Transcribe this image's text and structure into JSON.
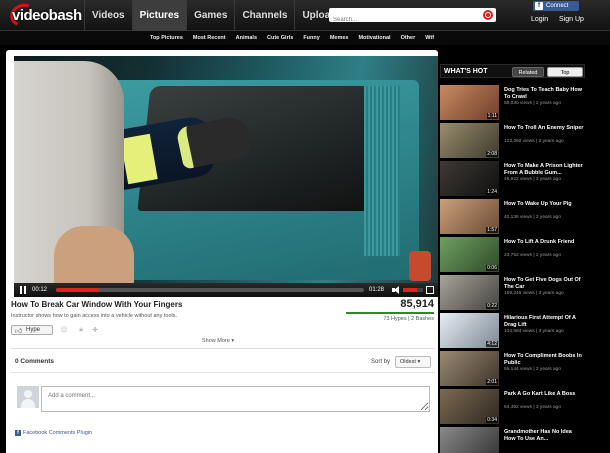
{
  "header": {
    "logo_text": "videobash",
    "nav": [
      "Videos",
      "Pictures",
      "Games",
      "Channels",
      "Upload"
    ],
    "active_nav": "Pictures",
    "search_placeholder": "Search...",
    "fb_connect": "Connect",
    "login": "Login",
    "signup": "Sign Up"
  },
  "subnav": [
    "Top Pictures",
    "Most Recent",
    "Animals",
    "Cute Girls",
    "Funny",
    "Memes",
    "Motivational",
    "Other",
    "Wtf"
  ],
  "player": {
    "current_time": "00:12",
    "duration": "01:28",
    "progress": 0.14,
    "volume": 0.7
  },
  "video": {
    "title": "How To Break Car Window With Your Fingers",
    "description": "Instructor shows how to gain access into a vehicle without any tools.",
    "views": "85,914",
    "votes": "73 Hypes | 2 Bashes",
    "hype_label": "Hype",
    "show_more": "Show More"
  },
  "comments": {
    "count_label": "0 Comments",
    "sort_by_label": "Sort by",
    "sort_selected": "Oldest",
    "input_placeholder": "Add a comment...",
    "plugin_label": "Facebook Comments Plugin"
  },
  "sidebar": {
    "heading": "WHAT'S HOT",
    "tabs": [
      "Related",
      "Top"
    ],
    "items": [
      {
        "title": "Dog Tries To Teach Baby How To Crawl",
        "views": "58,030",
        "age": "2 years ago",
        "duration": "1:11",
        "c1": "#c98a62",
        "c2": "#6e3e2a"
      },
      {
        "title": "How To Troll An Enemy Sniper",
        "views": "123,392",
        "age": "2 years ago",
        "duration": "2:08",
        "c1": "#9a8d6e",
        "c2": "#3d3a2c"
      },
      {
        "title": "How To Make A Prison Lighter From A Bubble Gum...",
        "views": "46,922",
        "age": "3 years ago",
        "duration": "1:24",
        "c1": "#3f3a35",
        "c2": "#0f0f0f"
      },
      {
        "title": "How To Wake Up Your Pig",
        "views": "40,136",
        "age": "2 years ago",
        "duration": "1:57",
        "c1": "#caa07b",
        "c2": "#6b4a33"
      },
      {
        "title": "How To Lift A Drunk Friend",
        "views": "23,752",
        "age": "2 years ago",
        "duration": "0:06",
        "c1": "#6fa060",
        "c2": "#2f4a2a"
      },
      {
        "title": "How To Get Five Dogs Out Of The Car",
        "views": "159,246",
        "age": "3 years ago",
        "duration": "0:22",
        "c1": "#a7a49b",
        "c2": "#45433e"
      },
      {
        "title": "Hilarious First Attempt Of A Drag Lift",
        "views": "104,584",
        "age": "3 years ago",
        "duration": "4:12",
        "c1": "#e7eef4",
        "c2": "#7c8793"
      },
      {
        "title": "How To Compliment Boobs In Public",
        "views": "55,144",
        "age": "2 years ago",
        "duration": "2:01",
        "c1": "#9b8a74",
        "c2": "#3c342a"
      },
      {
        "title": "Park A Go Kart Like A Boss",
        "views": "64,492",
        "age": "3 years ago",
        "duration": "0:34",
        "c1": "#7c6a52",
        "c2": "#2d271f"
      },
      {
        "title": "Grandmother Has No Idea How To Use An...",
        "views": "",
        "age": "",
        "duration": "",
        "c1": "#8a8a8a",
        "c2": "#303030"
      }
    ]
  }
}
